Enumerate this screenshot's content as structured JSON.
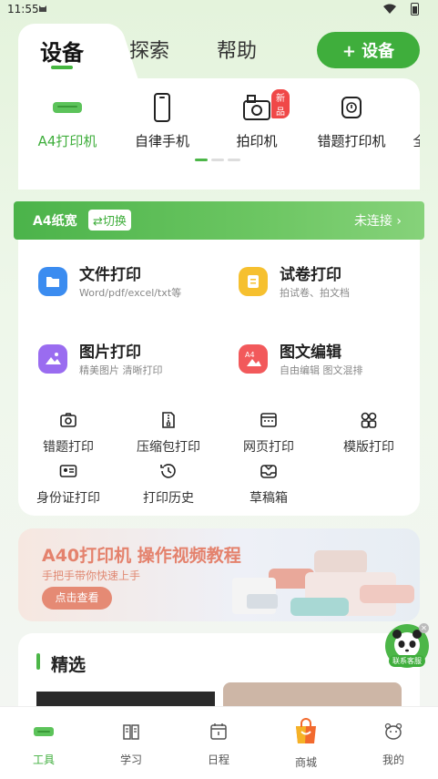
{
  "status_bar": {
    "time": "11:55"
  },
  "top_tabs": [
    {
      "label": "设备",
      "active": true
    },
    {
      "label": "探索",
      "active": false
    },
    {
      "label": "帮助",
      "active": false
    }
  ],
  "add_device_label": "+ 设备",
  "devices": [
    {
      "label": "A4打印机",
      "icon": "a4-printer-icon",
      "active": true
    },
    {
      "label": "自律手机",
      "icon": "phone-icon",
      "active": false
    },
    {
      "label": "拍印机",
      "icon": "camera-printer-icon",
      "active": false,
      "badge": "新品"
    },
    {
      "label": "错题打印机",
      "icon": "mistake-printer-icon",
      "active": false
    },
    {
      "label": "全",
      "icon": "",
      "active": false
    }
  ],
  "printer_strip": {
    "paper": "A4纸宽",
    "switch_label": "⇄切换",
    "connection": "未连接 ›"
  },
  "features": [
    {
      "title": "文件打印",
      "subtitle": "Word/pdf/excel/txt等",
      "icon": "folder-icon",
      "color": "#3b8cf0"
    },
    {
      "title": "试卷打印",
      "subtitle": "拍试卷、拍文档",
      "icon": "note-icon",
      "color": "#f6c02f"
    },
    {
      "title": "图片打印",
      "subtitle": "精美图片 清晰打印",
      "icon": "image-icon",
      "color": "#9a6cf0"
    },
    {
      "title": "图文编辑",
      "subtitle": "自由编辑 图文混排",
      "icon": "a4-edit-icon",
      "color": "#f2595b"
    }
  ],
  "tools": [
    {
      "label": "错题打印",
      "icon": "camera-outline-icon"
    },
    {
      "label": "压缩包打印",
      "icon": "zip-icon"
    },
    {
      "label": "网页打印",
      "icon": "web-icon"
    },
    {
      "label": "模版打印",
      "icon": "template-icon"
    },
    {
      "label": "身份证打印",
      "icon": "id-card-icon"
    },
    {
      "label": "打印历史",
      "icon": "history-icon"
    },
    {
      "label": "草稿箱",
      "icon": "draft-icon"
    }
  ],
  "banner": {
    "title": "A40打印机 操作视频教程",
    "subtitle": "手把手带你快速上手",
    "button": "点击查看"
  },
  "featured": {
    "title": "精选"
  },
  "service": {
    "label": "联系客服"
  },
  "bottom_nav": [
    {
      "label": "工具",
      "icon": "tools-icon",
      "active": true
    },
    {
      "label": "学习",
      "icon": "book-icon",
      "active": false
    },
    {
      "label": "日程",
      "icon": "calendar-icon",
      "active": false
    },
    {
      "label": "商城",
      "icon": "shopping-bag-icon",
      "active": false
    },
    {
      "label": "我的",
      "icon": "profile-icon",
      "active": false
    }
  ],
  "colors": {
    "accent": "#3fae3c",
    "background": "#e4f3dc",
    "banner_text": "#e4826d"
  }
}
